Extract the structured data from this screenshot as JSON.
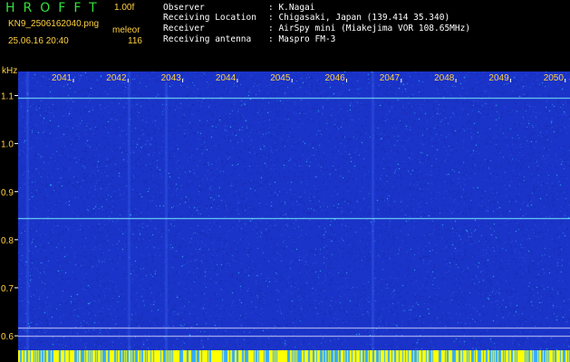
{
  "header": {
    "brand": "HROFFT",
    "version": "1.00f",
    "filename": "KN9_2506162040.png",
    "algorithm": "meleor",
    "datetime": "25.06.16 20:40",
    "count": "116"
  },
  "info": [
    {
      "label": "Observer",
      "value": ": K.Nagai"
    },
    {
      "label": "Receiving Location",
      "value": ": Chigasaki, Japan (139.414 35.340)"
    },
    {
      "label": "Receiver",
      "value": ": AirSpy mini (Miakejima VOR 108.65MHz)"
    },
    {
      "label": "Receiving antenna",
      "value": ": Maspro FM-3"
    }
  ],
  "spectrogram": {
    "y_unit": "kHz",
    "x_ticks": [
      "2041",
      "2042",
      "2043",
      "2044",
      "2045",
      "2046",
      "2047",
      "2048",
      "2049",
      "2050"
    ],
    "y_ticks": [
      "1.1",
      "1.0",
      "0.9",
      "0.8",
      "0.7",
      "0.6"
    ],
    "colors": {
      "background": "#1a33c8",
      "noise_low": "#2a55e0",
      "noise_high": "#33d4ff",
      "line": "#7af0ff",
      "axis_text": "#ffd040",
      "strip_a": "#ffff00",
      "strip_b": "#33aaff"
    }
  }
}
